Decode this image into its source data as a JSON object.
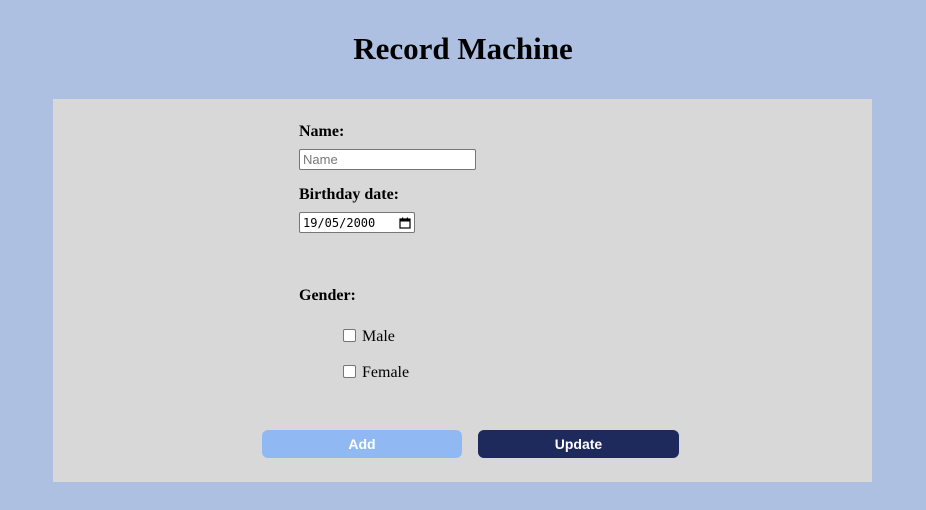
{
  "page": {
    "title": "Record Machine"
  },
  "form": {
    "name_label": "Name:",
    "name_placeholder": "Name",
    "name_value": "",
    "birthday_label": "Birthday date:",
    "birthday_value": "19/05/2000",
    "gender_label": "Gender:",
    "gender_options": [
      {
        "label": "Male",
        "checked": false
      },
      {
        "label": "Female",
        "checked": false
      }
    ]
  },
  "buttons": {
    "add_label": "Add",
    "update_label": "Update"
  },
  "icons": {
    "date_picker": "calendar-icon"
  },
  "colors": {
    "page_background": "#adc0e2",
    "card_background": "#d8d8d8",
    "add_button": "#90b9f4",
    "update_button": "#1f2a5c"
  }
}
